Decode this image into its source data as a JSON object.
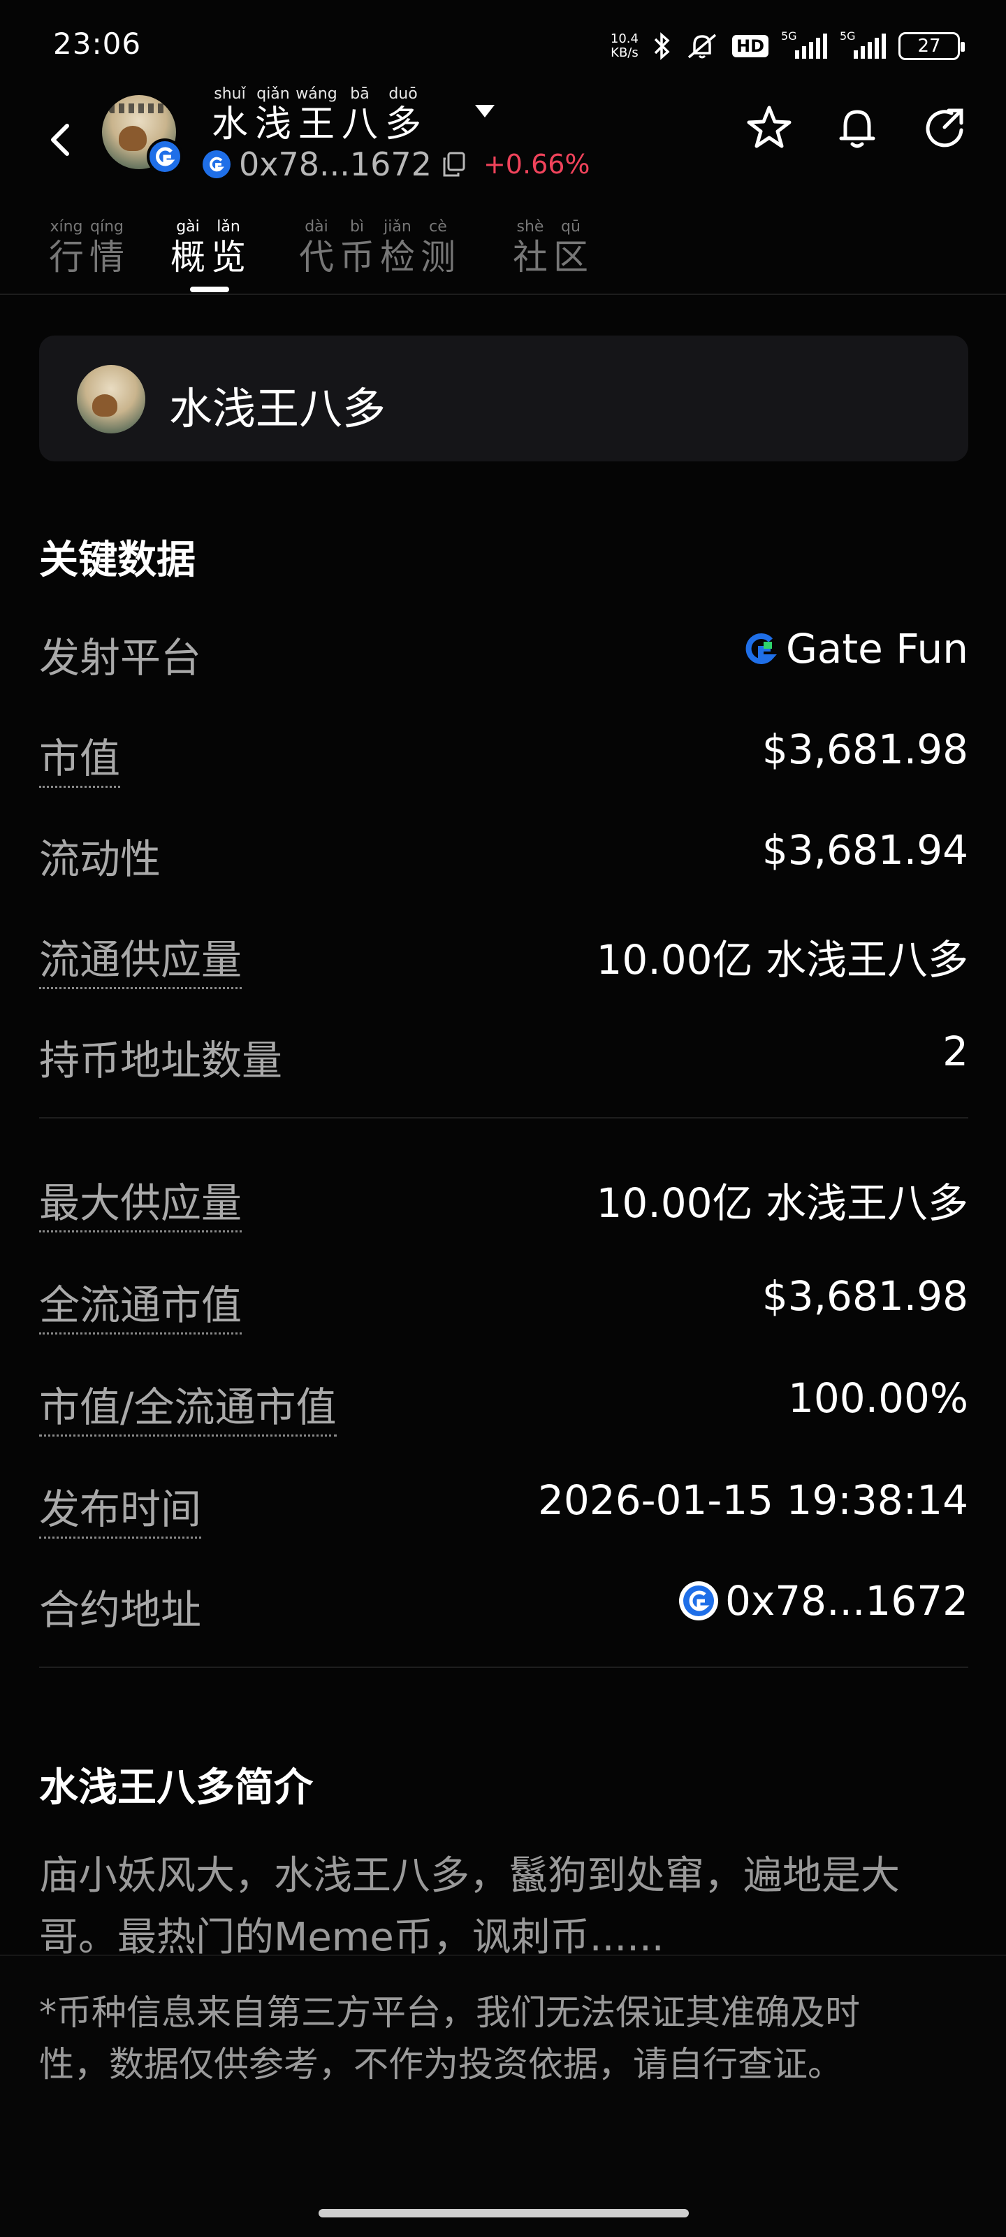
{
  "status_bar": {
    "time": "23:06",
    "net_speed_value": "10.4",
    "net_speed_unit": "KB/s",
    "hd_label": "HD",
    "sim1_label": "5G",
    "sim2_label": "5G",
    "battery": "27"
  },
  "header": {
    "title_chars": [
      {
        "py": "shuǐ",
        "hz": "水"
      },
      {
        "py": "qiǎn",
        "hz": "浅"
      },
      {
        "py": "wáng",
        "hz": "王"
      },
      {
        "py": "bā",
        "hz": "八"
      },
      {
        "py": "duō",
        "hz": "多"
      }
    ],
    "address": "0x78...1672",
    "change": "+0.66%"
  },
  "tabs": [
    {
      "chars": [
        {
          "py": "xíng",
          "hz": "行"
        },
        {
          "py": "qíng",
          "hz": "情"
        }
      ]
    },
    {
      "chars": [
        {
          "py": "gài",
          "hz": "概"
        },
        {
          "py": "lǎn",
          "hz": "览"
        }
      ]
    },
    {
      "chars": [
        {
          "py": "dài",
          "hz": "代"
        },
        {
          "py": "bì",
          "hz": "币"
        },
        {
          "py": "jiǎn",
          "hz": "检"
        },
        {
          "py": "cè",
          "hz": "测"
        }
      ]
    },
    {
      "chars": [
        {
          "py": "shè",
          "hz": "社"
        },
        {
          "py": "qū",
          "hz": "区"
        }
      ]
    }
  ],
  "token_card": {
    "name": "水浅王八多"
  },
  "key_data": {
    "title": "关键数据",
    "rows": [
      {
        "label": "发射平台",
        "value": "Gate Fun"
      },
      {
        "label": "市值",
        "value": "$3,681.98"
      },
      {
        "label": "流动性",
        "value": "$3,681.94"
      },
      {
        "label": "流通供应量",
        "value": "10.00亿 水浅王八多"
      },
      {
        "label": "持币地址数量",
        "value": "2"
      },
      {
        "label": "最大供应量",
        "value": "10.00亿 水浅王八多"
      },
      {
        "label": "全流通市值",
        "value": "$3,681.98"
      },
      {
        "label": "市值/全流通市值",
        "value": "100.00%"
      },
      {
        "label": "发布时间",
        "value": "2026-01-15 19:38:14"
      },
      {
        "label": "合约地址",
        "value": "0x78...1672"
      }
    ]
  },
  "intro": {
    "title": "水浅王八多简介",
    "text": " 庙小妖风大，水浅王八多，鬣狗到处窜，遍地是大哥。最热门的Meme币，讽刺币......"
  },
  "disclaimer": "*币种信息来自第三方平台，我们无法保证其准确及时性，数据仅供参考，不作为投资依据，请自行查证。",
  "colors": {
    "positive_change": "#f0435b",
    "gate_blue": "#1f6fe8",
    "gate_green": "#2fd36b"
  }
}
